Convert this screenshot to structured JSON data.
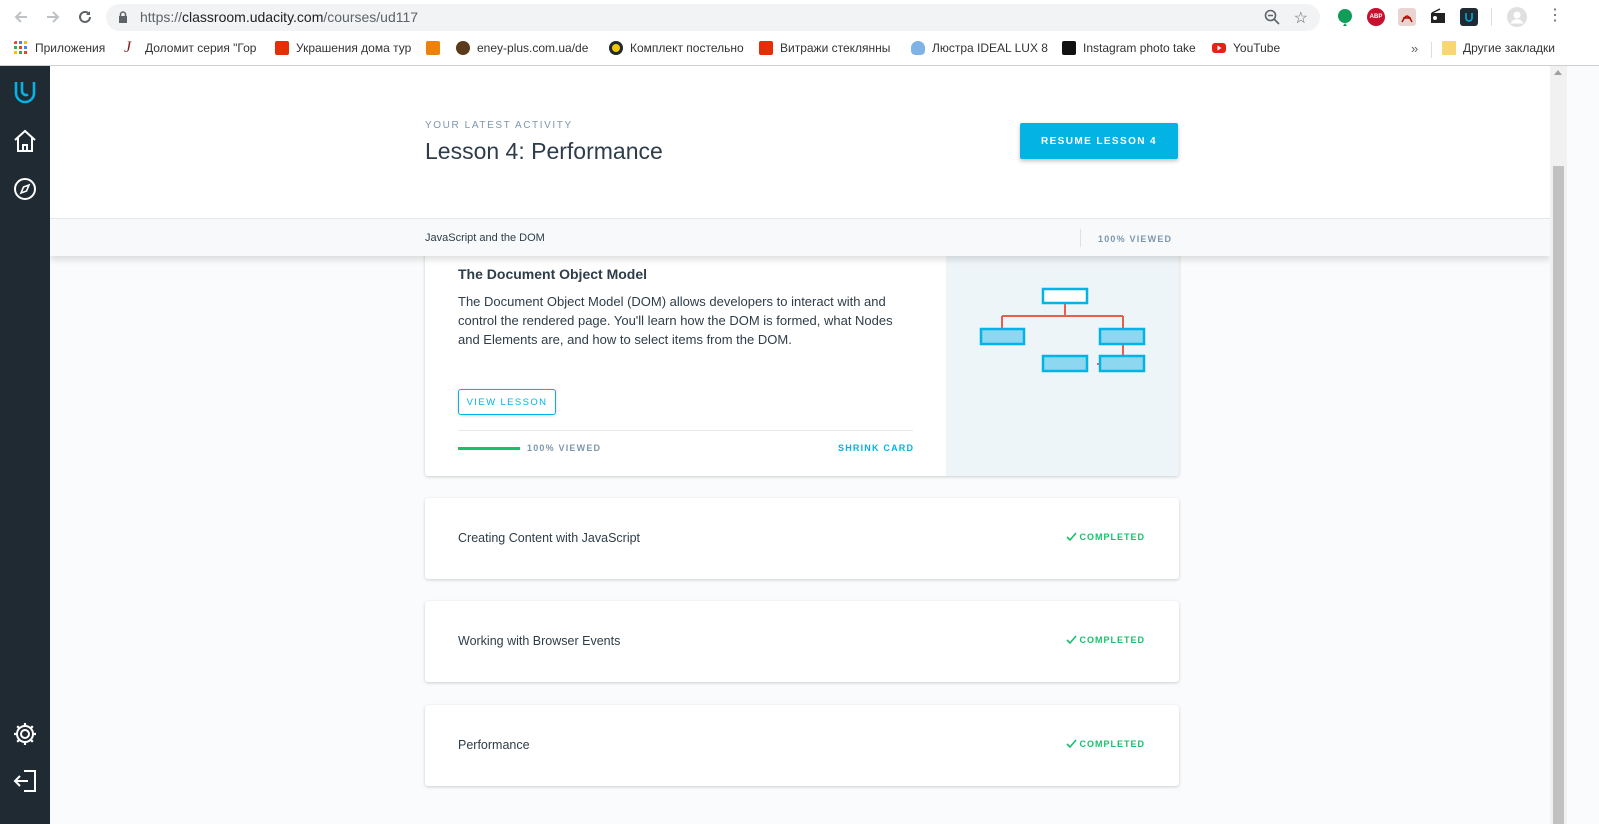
{
  "browser": {
    "url_prefix": "https://",
    "url_domain": "classroom.udacity.com",
    "url_path": "/courses/ud117",
    "extensions": {
      "abp_label": "ABP"
    }
  },
  "bookmarks": [
    {
      "label": "Приложения",
      "icon": "apps-grid-icon",
      "color": "#4285f4"
    },
    {
      "label": "Доломит серия \"Гор",
      "icon": "script-j-icon",
      "color": "#8b1a1a"
    },
    {
      "label": "Украшения дома тур",
      "icon": "aliexpress-icon",
      "color": "#e62e04"
    },
    {
      "label": "",
      "icon": "odnoklassniki-icon",
      "color": "#ee8208"
    },
    {
      "label": "eney-plus.com.ua/de",
      "icon": "eney-icon",
      "color": "#5a3a1a"
    },
    {
      "label": "Комплект постельно",
      "icon": "target-icon",
      "color": "#f2c500"
    },
    {
      "label": "Витражи стеклянны",
      "icon": "aliexpress-icon",
      "color": "#e62e04"
    },
    {
      "label": "Люстра IDEAL LUX 8",
      "icon": "lightbulb-icon",
      "color": "#7fb2e5"
    },
    {
      "label": "Instagram photo take",
      "icon": "ink-icon",
      "color": "#111111"
    },
    {
      "label": "YouTube",
      "icon": "youtube-icon",
      "color": "#e62117"
    }
  ],
  "bookmarks_more": "»",
  "other_bookmarks": "Другие закладки",
  "activity": {
    "label": "YOUR LATEST ACTIVITY",
    "title": "Lesson 4: Performance",
    "resume_button": "RESUME LESSON 4"
  },
  "sticky": {
    "course_title": "JavaScript and the DOM",
    "viewed": "100% VIEWED"
  },
  "expanded_lesson": {
    "title": "The Document Object Model",
    "description": "The Document Object Model (DOM) allows developers to interact with and control the rendered page. You'll learn how the DOM is formed, what Nodes and Elements are, and how to select items from the DOM.",
    "view_button": "VIEW LESSON",
    "progress_fraction": 1.0,
    "progress_text": "100% VIEWED",
    "shrink_label": "SHRINK CARD"
  },
  "lessons": [
    {
      "title": "Creating Content with JavaScript",
      "status": "COMPLETED"
    },
    {
      "title": "Working with Browser Events",
      "status": "COMPLETED"
    },
    {
      "title": "Performance",
      "status": "COMPLETED"
    }
  ],
  "colors": {
    "accent": "#02b3e4",
    "success": "#15c26b",
    "sidebar": "#1f2a33",
    "text": "#2e3d49"
  }
}
